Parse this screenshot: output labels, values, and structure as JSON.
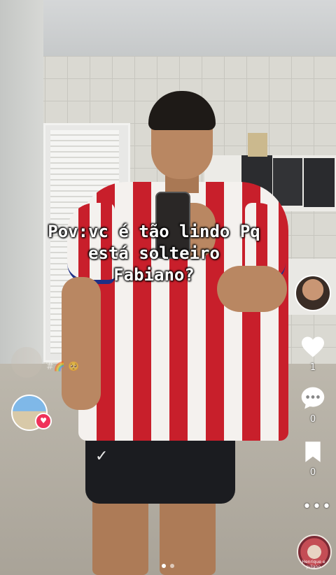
{
  "caption": {
    "line1": "Pov:vc é tão lindo Pq",
    "line2": "está solteiro",
    "line3": "Fabiano?"
  },
  "actions": {
    "like": {
      "icon": "heart-icon",
      "count": "1"
    },
    "comment": {
      "icon": "comment-icon",
      "count": "0"
    },
    "save": {
      "icon": "bookmark-icon",
      "count": "0"
    },
    "more": {
      "icon": "more-icon",
      "glyph": "•••"
    }
  },
  "left_overlay": {
    "ghost_text": "#🌈 🥺",
    "heart_badge": "♥"
  },
  "music_disc": {
    "label": "Henrique e Juliano"
  },
  "pager": {
    "pages": 2,
    "active": 1
  },
  "colors": {
    "like_red": "#f0325a",
    "text_white": "#ffffff"
  }
}
